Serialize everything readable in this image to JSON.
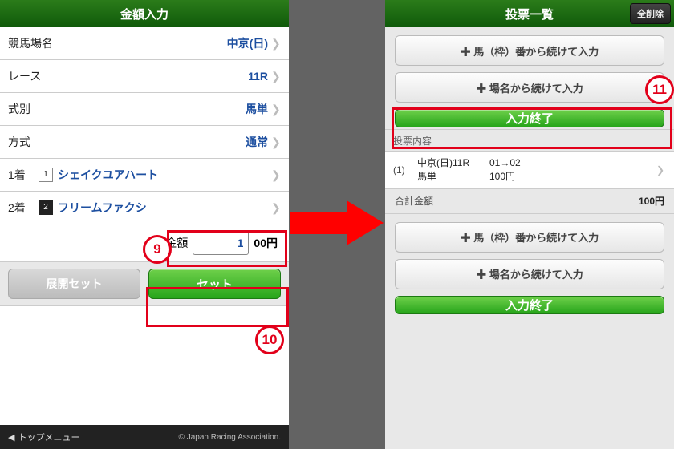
{
  "left": {
    "title": "金額入力",
    "rows": {
      "place_label": "競馬場名",
      "place_value": "中京(日)",
      "race_label": "レース",
      "race_value": "11R",
      "bettype_label": "式別",
      "bettype_value": "馬単",
      "method_label": "方式",
      "method_value": "通常",
      "p1_label": "1着",
      "p1_num": "1",
      "p1_horse": "シェイクユアハート",
      "p2_label": "2着",
      "p2_num": "2",
      "p2_horse": "フリームファクシ"
    },
    "amount": {
      "label": "金額",
      "value": "1",
      "suffix": "00円"
    },
    "buttons": {
      "expand": "展開セット",
      "set": "セット"
    },
    "footer": {
      "back": "トップメニュー",
      "copy": "© Japan Racing Association."
    }
  },
  "right": {
    "title": "投票一覧",
    "delete_all": "全削除",
    "btn_horse": "✚ 馬（枠）番から続けて入力",
    "btn_place": "✚ 場名から続けて入力",
    "btn_finish": "入力終了",
    "section": "投票内容",
    "bet": {
      "idx": "(1)",
      "line1a": "中京(日)11R",
      "line1b": "01→02",
      "line2a": "馬単",
      "line2b": "100円"
    },
    "total_label": "合計金額",
    "total_value": "100円"
  },
  "callouts": {
    "c9": "9",
    "c10": "10",
    "c11": "11"
  }
}
